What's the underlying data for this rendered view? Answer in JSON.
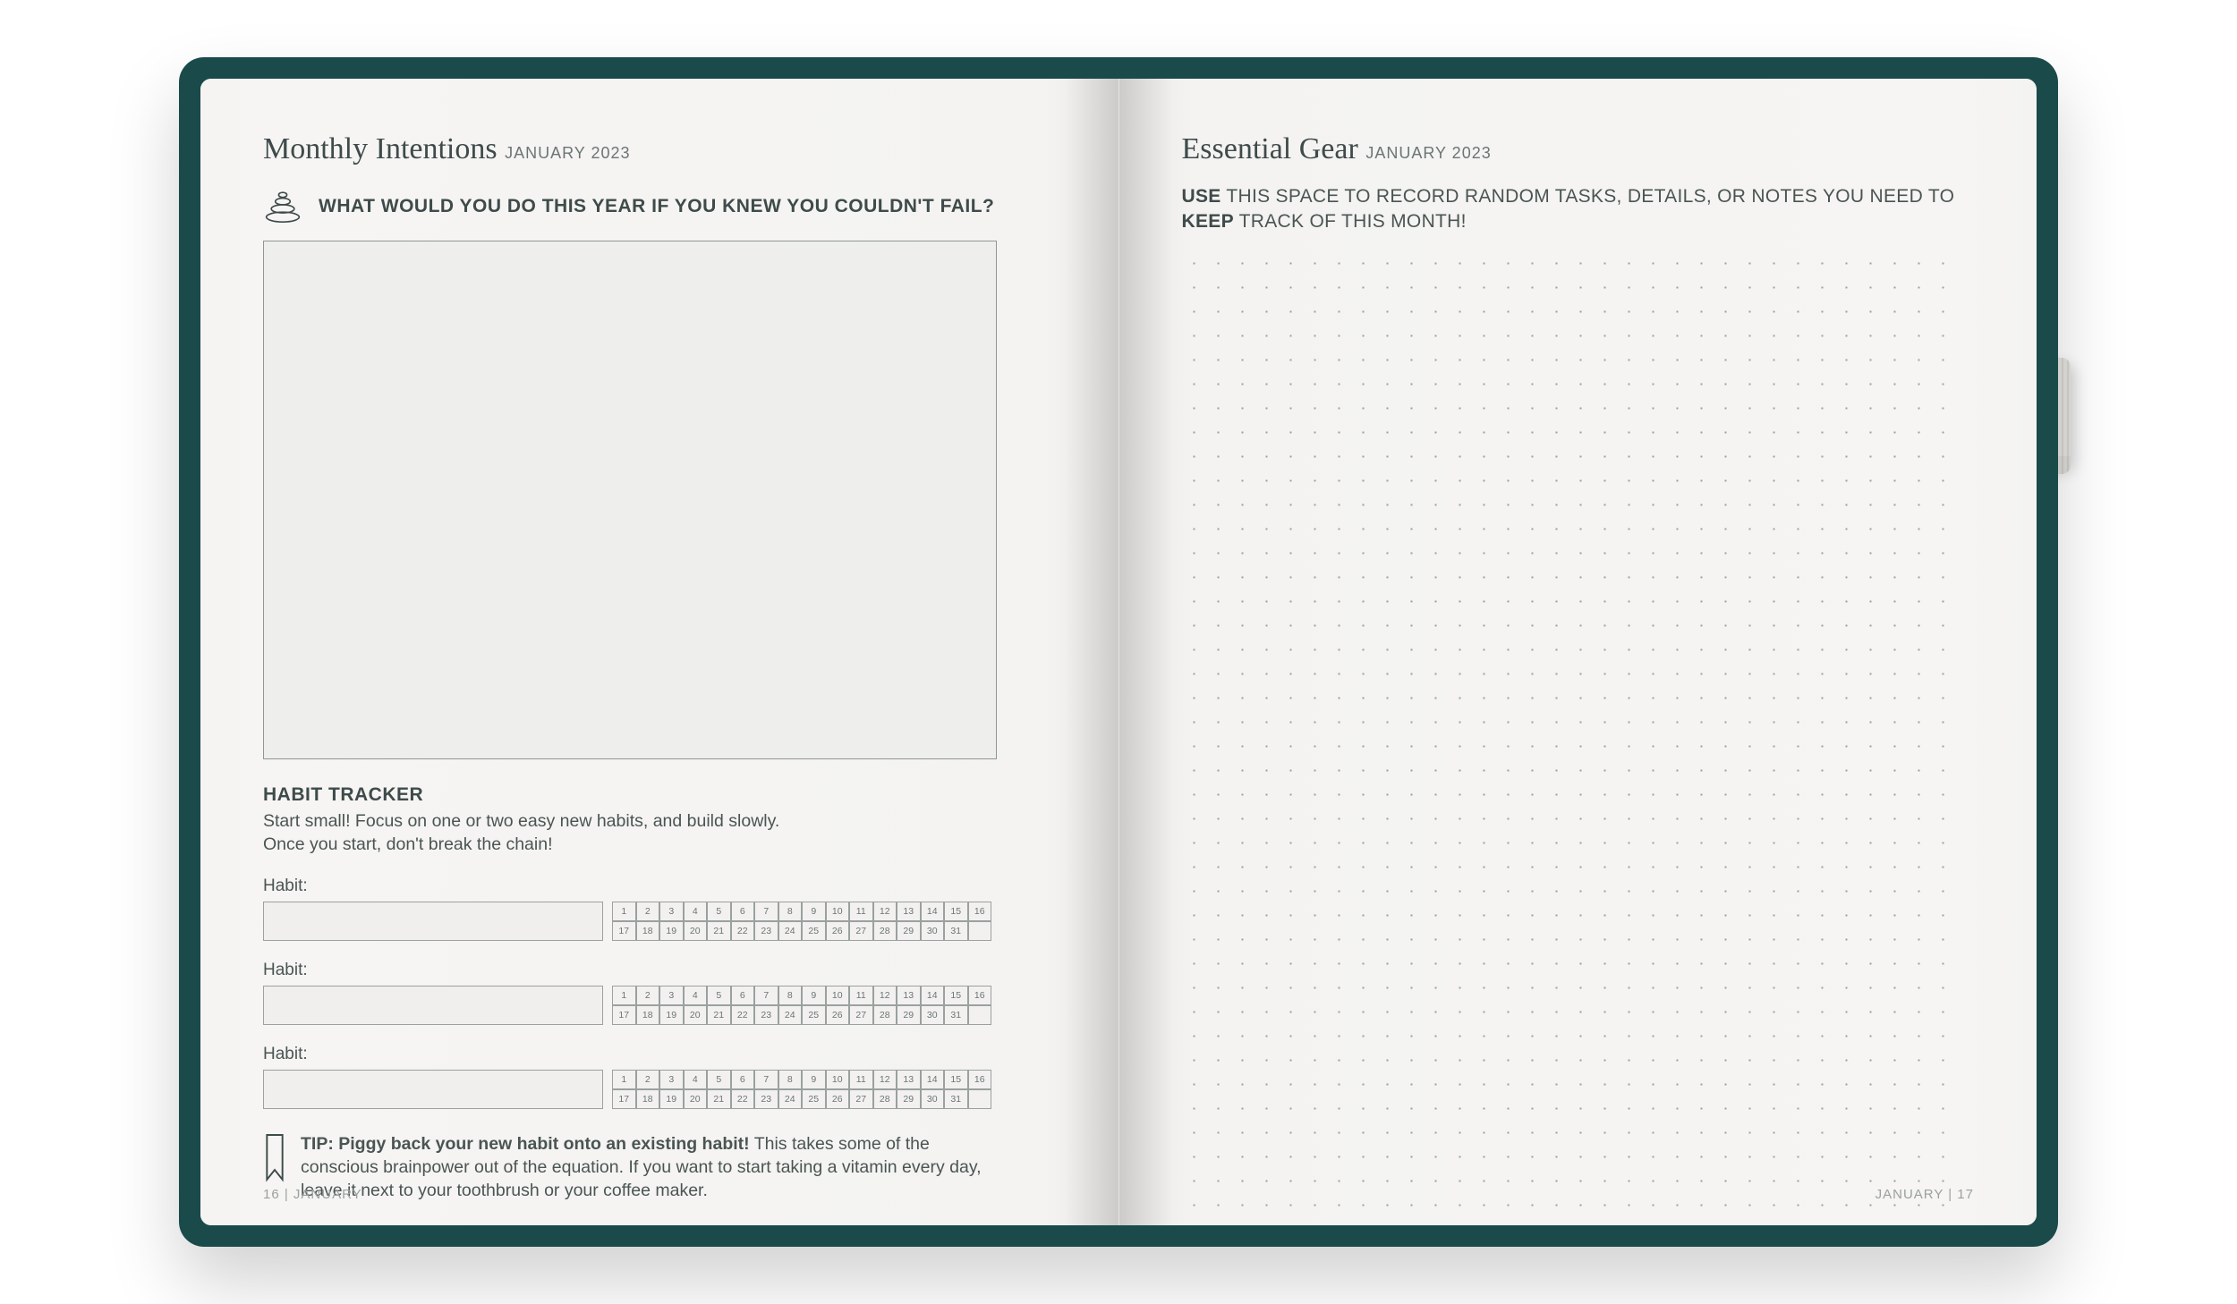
{
  "left": {
    "title": "Monthly Intentions",
    "subtitle": "JANUARY 2023",
    "prompt": "WHAT WOULD YOU DO THIS YEAR IF YOU KNEW YOU COULDN'T FAIL?",
    "habit": {
      "heading": "HABIT TRACKER",
      "desc_line1": "Start small! Focus on one or two easy new habits, and build slowly.",
      "desc_line2": "Once you start, don't break the chain!",
      "label": "Habit:",
      "days_row1": [
        1,
        2,
        3,
        4,
        5,
        6,
        7,
        8,
        9,
        10,
        11,
        12,
        13,
        14,
        15,
        16
      ],
      "days_row2": [
        17,
        18,
        19,
        20,
        21,
        22,
        23,
        24,
        25,
        26,
        27,
        28,
        29,
        30,
        31,
        ""
      ]
    },
    "tip": {
      "bold": "TIP: Piggy back your new habit onto an existing habit!",
      "rest": " This takes some of the conscious brainpower out of the equation. If you want to start taking a vitamin every day, leave it next to your toothbrush or your coffee maker."
    },
    "footer": "16  |  JANUARY"
  },
  "right": {
    "title": "Essential Gear",
    "subtitle": "JANUARY 2023",
    "instruction_bold": "USE",
    "instruction_rest": " THIS SPACE TO RECORD RANDOM TASKS, DETAILS, OR NOTES YOU NEED TO ",
    "instruction_bold2": "KEEP",
    "instruction_rest2": " TRACK OF THIS MONTH!",
    "footer": "JANUARY  |  17"
  }
}
